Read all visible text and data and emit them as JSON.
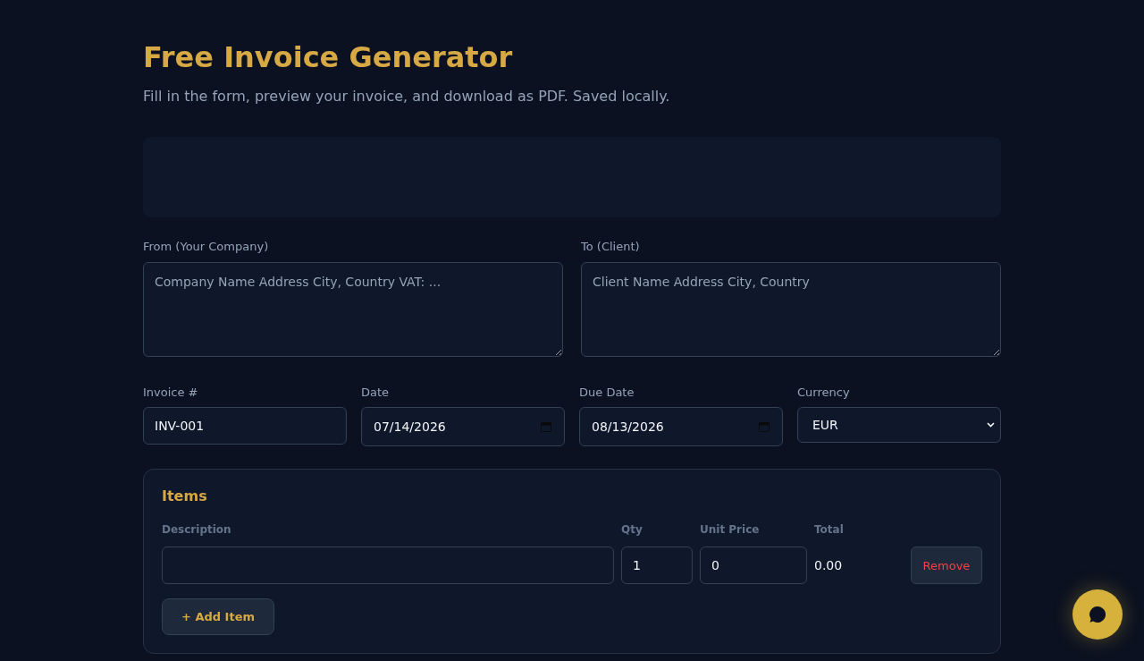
{
  "header": {
    "title": "Free Invoice Generator",
    "subtitle": "Fill in the form, preview your invoice, and download as PDF. Saved locally."
  },
  "parties": [
    {
      "label": "From (Your Company)",
      "placeholder": "Company Name Address City, Country VAT: ..."
    },
    {
      "label": "To (Client)",
      "placeholder": "Client Name Address City, Country"
    }
  ],
  "details": [
    {
      "kind": "text",
      "label": "Invoice #",
      "value": "INV-001"
    },
    {
      "kind": "date",
      "label": "Date",
      "value": "07/14/2026"
    },
    {
      "kind": "date",
      "label": "Due Date",
      "value": "08/13/2026"
    },
    {
      "kind": "select",
      "label": "Currency",
      "value": "EUR"
    }
  ],
  "items": {
    "title": "Items",
    "columns": [
      "Description",
      "Qty",
      "Unit Price",
      "Total"
    ],
    "rows": [
      {
        "qty": "1",
        "unit_price": "0",
        "total": "0.00",
        "remove_label": "Remove"
      }
    ],
    "add_button": "+ Add Item"
  }
}
